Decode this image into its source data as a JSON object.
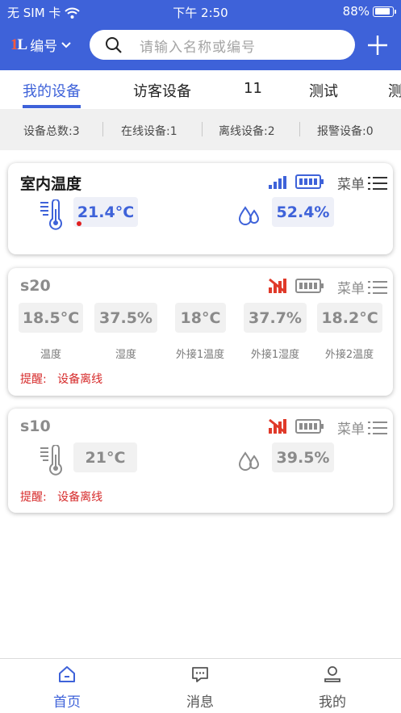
{
  "status_bar": {
    "carrier": "无 SIM 卡",
    "time": "下午 2:50",
    "battery": "88%"
  },
  "header": {
    "code_label": "编号",
    "logo_text": "1L",
    "search_placeholder": "请输入名称或编号"
  },
  "tabs": [
    {
      "label": "我的设备",
      "active": true
    },
    {
      "label": "访客设备"
    },
    {
      "label": "11"
    },
    {
      "label": "测试"
    },
    {
      "label": "测"
    }
  ],
  "summary": [
    "设备总数:3",
    "在线设备:1",
    "离线设备:2",
    "报警设备:0"
  ],
  "devices": [
    {
      "name": "室内温度",
      "online": true,
      "menu_label": "菜单",
      "temperature": "21.4°C",
      "humidity": "52.4%"
    },
    {
      "name": "s20",
      "online": false,
      "menu_label": "菜单",
      "values": [
        {
          "value": "18.5°C",
          "label": "温度"
        },
        {
          "value": "37.5%",
          "label": "湿度"
        },
        {
          "value": "18°C",
          "label": "外接1温度"
        },
        {
          "value": "37.7%",
          "label": "外接1湿度"
        },
        {
          "value": "18.2°C",
          "label": "外接2温度"
        }
      ],
      "remind_label": "提醒:",
      "remind_text": "设备离线"
    },
    {
      "name": "s10",
      "online": false,
      "menu_label": "菜单",
      "temperature": "21°C",
      "humidity": "39.5%",
      "remind_label": "提醒:",
      "remind_text": "设备离线"
    }
  ],
  "bottom_nav": [
    {
      "label": "首页",
      "icon": "home-icon",
      "active": true
    },
    {
      "label": "消息",
      "icon": "message-icon"
    },
    {
      "label": "我的",
      "icon": "profile-icon"
    }
  ],
  "colors": {
    "primary": "#3e62d9",
    "offline_red": "#d62a2a",
    "background_gray": "#f0f0f0"
  }
}
